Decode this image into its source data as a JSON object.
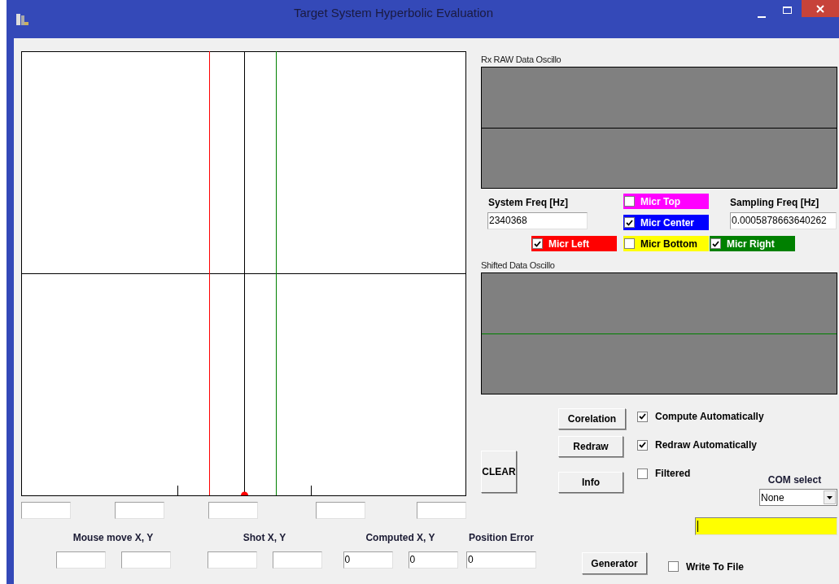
{
  "window": {
    "title": "Target System Hyperbolic  Evaluation"
  },
  "raw_oscillo": {
    "label": "Rx RAW Data Oscillo"
  },
  "system_freq": {
    "label": "System Freq [Hz]",
    "value": "2340368"
  },
  "sampling_freq": {
    "label": "Sampling  Freq [Hz]",
    "value": "0.0005878663640262"
  },
  "mics": [
    {
      "label": "Micr Top",
      "checked": false,
      "color": "#ff00ff"
    },
    {
      "label": "Micr Center",
      "checked": true,
      "color": "#0000ff"
    },
    {
      "label": "Micr Left",
      "checked": true,
      "color": "#ff0000"
    },
    {
      "label": "Micr Bottom",
      "checked": false,
      "color": "#ffff00"
    },
    {
      "label": "Micr Right",
      "checked": true,
      "color": "#008000"
    }
  ],
  "shifted_oscillo": {
    "label": "Shifted Data Oscillo"
  },
  "action_buttons": [
    "Corelation",
    "Redraw",
    "Info"
  ],
  "clear_button": "CLEAR",
  "options": [
    {
      "label": "Compute Automatically",
      "checked": true
    },
    {
      "label": "Redraw Automatically",
      "checked": true
    },
    {
      "label": "Filtered",
      "checked": false
    }
  ],
  "com_select": {
    "label": "COM select",
    "value": "None"
  },
  "generator_button": "Generator",
  "write_to_file": {
    "label": "Write To File",
    "checked": false
  },
  "readouts": [
    {
      "label": "Mouse move X, Y"
    },
    {
      "label": "Shot X, Y"
    },
    {
      "label": "Computed X, Y",
      "values": [
        "0",
        "0"
      ]
    },
    {
      "label": "Position Error",
      "values": [
        "0"
      ]
    }
  ]
}
